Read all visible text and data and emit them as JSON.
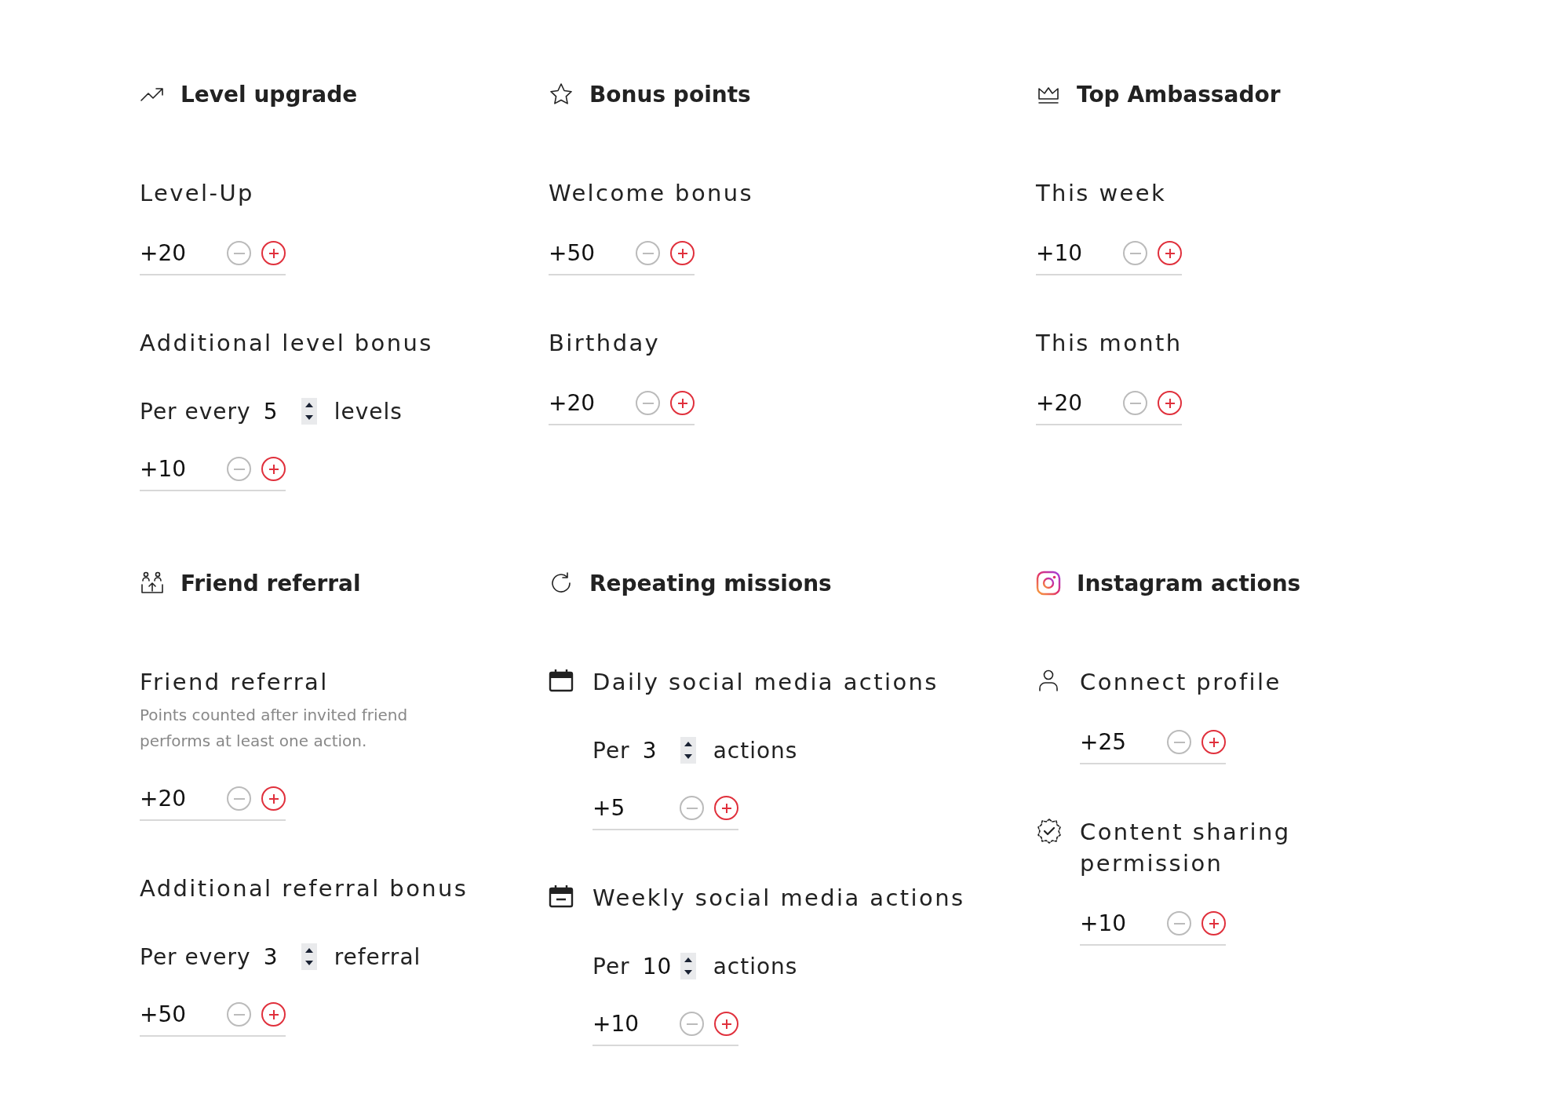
{
  "sections": [
    {
      "title": "Level upgrade",
      "items": [
        {
          "label": "Level-Up",
          "points": "+20"
        },
        {
          "label": "Additional level bonus",
          "per": {
            "prefix": "Per every",
            "value": "5",
            "suffix": "levels"
          },
          "points": "+10"
        }
      ]
    },
    {
      "title": "Bonus points",
      "items": [
        {
          "label": "Welcome bonus",
          "points": "+50"
        },
        {
          "label": "Birthday",
          "points": "+20"
        }
      ]
    },
    {
      "title": "Top Ambassador",
      "items": [
        {
          "label": "This week",
          "points": "+10"
        },
        {
          "label": "This month",
          "points": "+20"
        }
      ]
    },
    {
      "title": "Friend referral",
      "items": [
        {
          "label": "Friend referral",
          "note": "Points counted after invited friend performs at least one action.",
          "points": "+20"
        },
        {
          "label": "Additional referral bonus",
          "per": {
            "prefix": "Per every",
            "value": "3",
            "suffix": "referral"
          },
          "points": "+50"
        }
      ]
    },
    {
      "title": "Repeating missions",
      "items": [
        {
          "label": "Daily social media actions",
          "per": {
            "prefix": "Per",
            "value": "3",
            "suffix": "actions"
          },
          "points": "+5"
        },
        {
          "label": "Weekly social media actions",
          "per": {
            "prefix": "Per",
            "value": "10",
            "suffix": "actions"
          },
          "points": "+10"
        }
      ]
    },
    {
      "title": "Instagram actions",
      "items": [
        {
          "label": "Connect profile",
          "points": "+25"
        },
        {
          "label": "Content sharing permission",
          "points": "+10"
        }
      ]
    }
  ]
}
